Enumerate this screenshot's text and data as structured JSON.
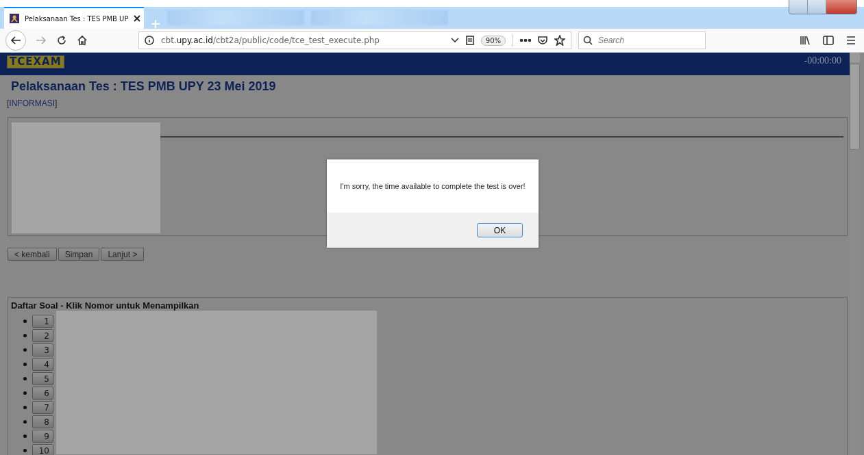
{
  "browser": {
    "tabs": [
      {
        "title": "Pelaksanaan Tes : TES PMB UP",
        "selected": true,
        "kind": "page"
      },
      {
        "selected": false,
        "kind": "blurred"
      },
      {
        "selected": false,
        "kind": "blurred"
      }
    ],
    "url": {
      "host_prefix": "cbt.",
      "host": "upy.ac.id",
      "path": "/cbt2a/public/code/tce_test_execute.php"
    },
    "zoom": "90%",
    "search": {
      "placeholder": "Search"
    }
  },
  "header": {
    "logo": "TCEXAM",
    "timer": "-00:00:00"
  },
  "title": "Pelaksanaan Tes : TES PMB UPY 23 Mei 2019",
  "info_link": {
    "open": "[",
    "label": "INFORMASI",
    "close": "]"
  },
  "nav_buttons": [
    "< kembali",
    "Simpan",
    "Lanjut >"
  ],
  "question_list": {
    "title": "Daftar Soal - Klik Nomor untuk Menampilkan",
    "items": [
      "1",
      "2",
      "3",
      "4",
      "5",
      "6",
      "7",
      "8",
      "9",
      "10"
    ]
  },
  "dialog": {
    "message": "I'm sorry, the time available to complete the test is over!",
    "button": "OK"
  }
}
